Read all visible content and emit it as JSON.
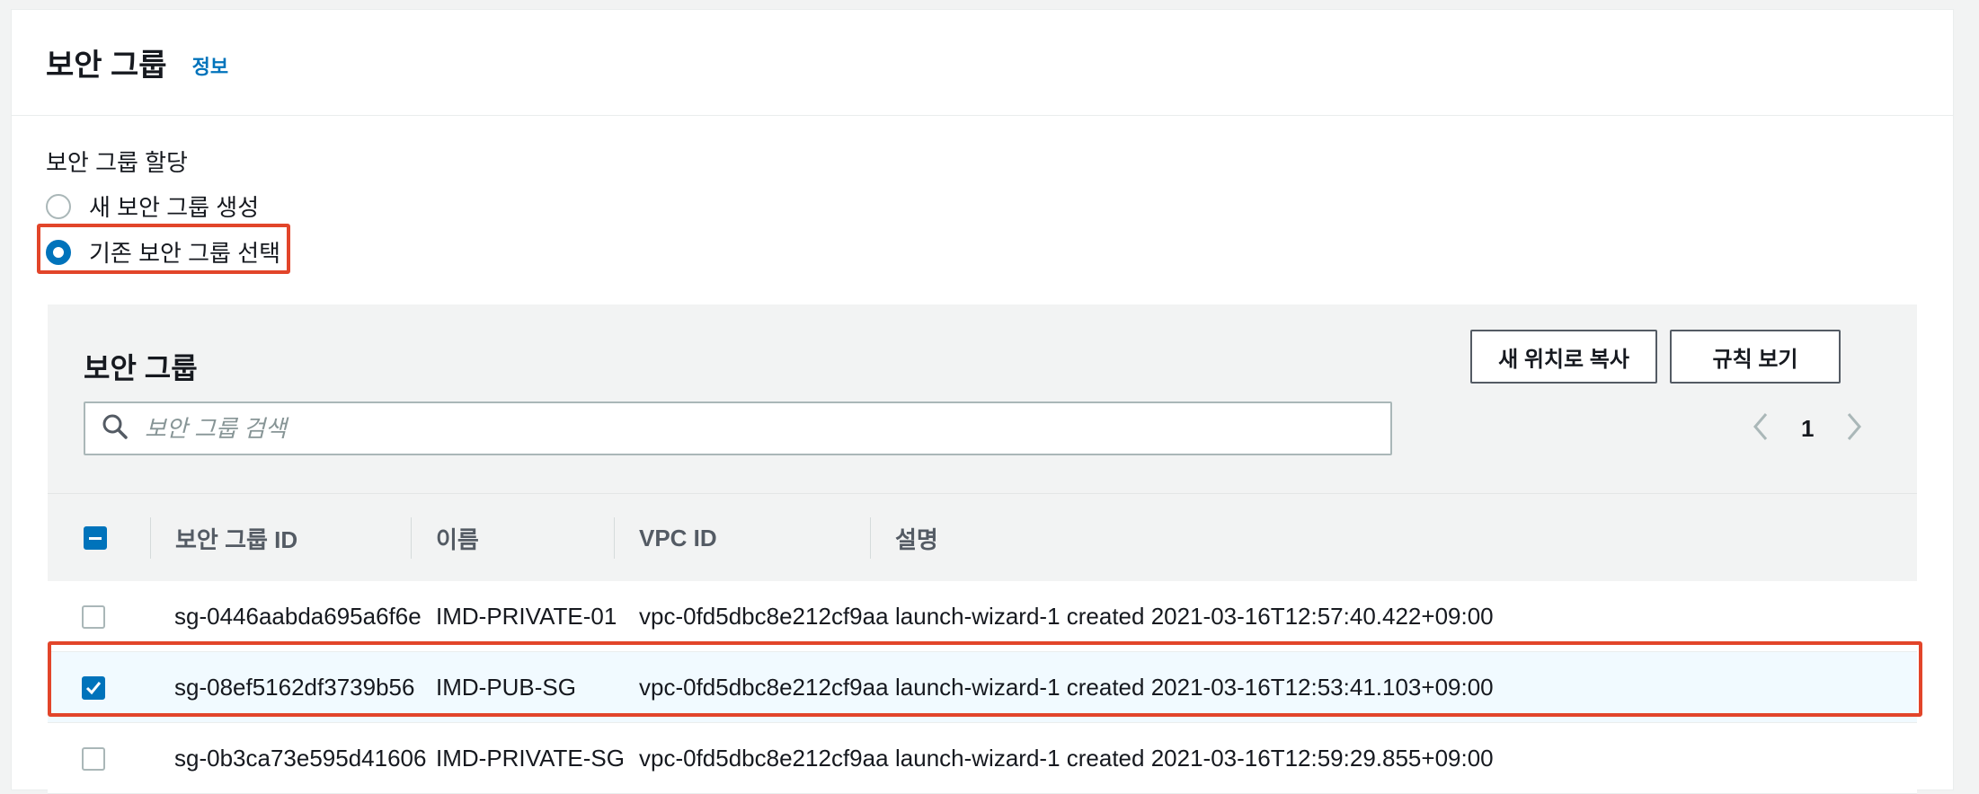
{
  "panel": {
    "title": "보안 그룹",
    "info_link": "정보"
  },
  "assignment": {
    "label": "보안 그룹 할당",
    "options": [
      {
        "label": "새 보안 그룹 생성",
        "selected": false
      },
      {
        "label": "기존 보안 그룹 선택",
        "selected": true
      }
    ]
  },
  "table_panel": {
    "title": "보안 그룹",
    "copy_button": "새 위치로 복사",
    "rules_button": "규칙 보기",
    "search_placeholder": "보안 그룹 검색",
    "page_number": "1"
  },
  "table": {
    "columns": [
      "보안 그룹 ID",
      "이름",
      "VPC ID",
      "설명"
    ],
    "rows": [
      {
        "id": "sg-0446aabda695a6f6e",
        "name": "IMD-PRIVATE-01",
        "vpc": "vpc-0fd5dbc8e212cf9aa",
        "desc": "launch-wizard-1 created 2021-03-16T12:57:40.422+09:00",
        "checked": false
      },
      {
        "id": "sg-08ef5162df3739b56",
        "name": "IMD-PUB-SG",
        "vpc": "vpc-0fd5dbc8e212cf9aa",
        "desc": "launch-wizard-1 created 2021-03-16T12:53:41.103+09:00",
        "checked": true
      },
      {
        "id": "sg-0b3ca73e595d41606",
        "name": "IMD-PRIVATE-SG",
        "vpc": "vpc-0fd5dbc8e212cf9aa",
        "desc": "launch-wizard-1 created 2021-03-16T12:59:29.855+09:00",
        "checked": false
      }
    ]
  },
  "colors": {
    "accent": "#0073bb",
    "highlight": "#e2452a"
  },
  "icons": {
    "search": "search-icon",
    "prev": "chevron-left-icon",
    "next": "chevron-right-icon"
  }
}
